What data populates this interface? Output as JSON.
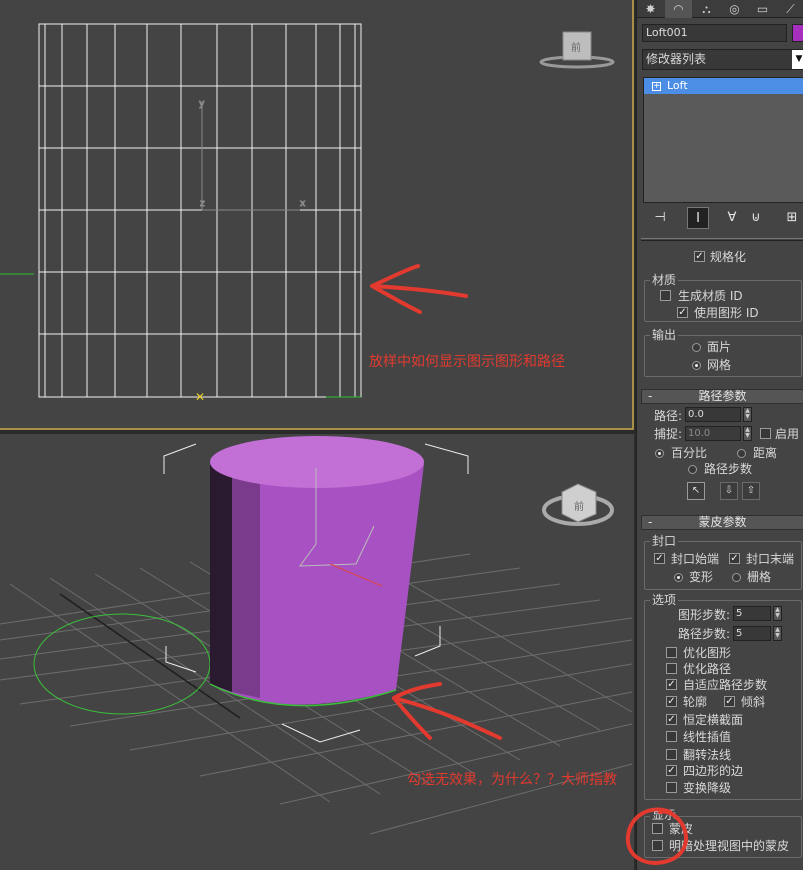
{
  "viewport_top": {
    "annotation": "放样中如何显示图示图形和路径",
    "viewcube_label": "前"
  },
  "viewport_bottom": {
    "annotation": "勾选无效果，为什么？？大师指教",
    "viewcube_label": "前"
  },
  "panel": {
    "tabs": [
      "✸",
      "◠",
      "⛬",
      "◎",
      "▭",
      "⟋"
    ],
    "object_name": "Loft001",
    "object_color": "#a62fc0",
    "modifier_list": "修改器列表",
    "stack_item": "Loft",
    "stack_tools": [
      "⊣",
      "Ⅰ",
      "∀",
      "⊍",
      "⊞"
    ],
    "skin_top": {
      "normalize_label": "规格化",
      "normalize_checked": true,
      "material_group": "材质",
      "gen_material_id": "生成材质 ID",
      "use_shape_id": "使用图形 ID",
      "output_group": "输出",
      "output_patch": "面片",
      "output_mesh": "网格"
    },
    "path_params": {
      "title": "路径参数",
      "path_label": "路径:",
      "path_value": "0.0",
      "snap_label": "捕捉:",
      "snap_value": "10.0",
      "enable_label": "启用",
      "percent_label": "百分比",
      "distance_label": "距离",
      "path_steps_label": "路径步数"
    },
    "skin_params": {
      "title": "蒙皮参数",
      "capping_group": "封口",
      "cap_start": "封口始端",
      "cap_end": "封口末端",
      "morph": "变形",
      "grid": "栅格",
      "options_group": "选项",
      "shape_steps_label": "图形步数:",
      "shape_steps_value": "5",
      "path_steps_label": "路径步数:",
      "path_steps_value": "5",
      "optimize_shapes": "优化图形",
      "optimize_path": "优化路径",
      "adaptive_path_steps": "自适应路径步数",
      "contour": "轮廓",
      "banking": "倾斜",
      "constant_cross_section": "恒定横截面",
      "linear_interpolation": "线性插值",
      "flip_normals": "翻转法线",
      "quad_sided": "四边形的边",
      "transform_degrade": "变换降级",
      "display_group": "显示",
      "skin": "蒙皮",
      "skin_in_shaded": "明暗处理视图中的蒙皮"
    }
  },
  "colors": {
    "viewport_bg": "#444444",
    "annotation_red": "#e23a2f",
    "loft_purple": "#b35ccc",
    "active_border": "#a88f4a"
  }
}
